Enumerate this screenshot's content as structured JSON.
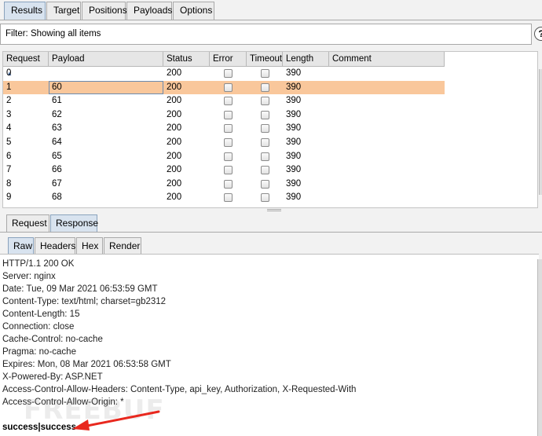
{
  "main_tabs": [
    "Results",
    "Target",
    "Positions",
    "Payloads",
    "Options"
  ],
  "filter": {
    "text": "Filter: Showing all items",
    "help": "?"
  },
  "table": {
    "columns": [
      "Request",
      "Payload",
      "Status",
      "Error",
      "Timeout",
      "Length",
      "Comment"
    ],
    "sort_indicator": "▲",
    "rows": [
      {
        "request": "0",
        "payload": "",
        "status": "200",
        "length": "390"
      },
      {
        "request": "1",
        "payload": "60",
        "status": "200",
        "length": "390"
      },
      {
        "request": "2",
        "payload": "61",
        "status": "200",
        "length": "390"
      },
      {
        "request": "3",
        "payload": "62",
        "status": "200",
        "length": "390"
      },
      {
        "request": "4",
        "payload": "63",
        "status": "200",
        "length": "390"
      },
      {
        "request": "5",
        "payload": "64",
        "status": "200",
        "length": "390"
      },
      {
        "request": "6",
        "payload": "65",
        "status": "200",
        "length": "390"
      },
      {
        "request": "7",
        "payload": "66",
        "status": "200",
        "length": "390"
      },
      {
        "request": "8",
        "payload": "67",
        "status": "200",
        "length": "390"
      },
      {
        "request": "9",
        "payload": "68",
        "status": "200",
        "length": "390"
      }
    ]
  },
  "req_resp_tabs": [
    "Request",
    "Response"
  ],
  "view_tabs": [
    "Raw",
    "Headers",
    "Hex",
    "Render"
  ],
  "response": {
    "headers": [
      "HTTP/1.1 200 OK",
      "Server: nginx",
      "Date: Tue, 09 Mar 2021 06:53:59 GMT",
      "Content-Type: text/html; charset=gb2312",
      "Content-Length: 15",
      "Connection: close",
      "Cache-Control: no-cache",
      "Pragma: no-cache",
      "Expires: Mon, 08 Mar 2021 06:53:58 GMT",
      "X-Powered-By: ASP.NET",
      "Access-Control-Allow-Headers: Content-Type, api_key, Authorization, X-Requested-With",
      "Access-Control-Allow-Origin: *"
    ],
    "body": "success|success"
  },
  "watermark": "FREEBUF",
  "colors": {
    "selected_row": "#f9c79b",
    "active_tab": "#d8e3ef",
    "arrow": "#e8281e"
  }
}
